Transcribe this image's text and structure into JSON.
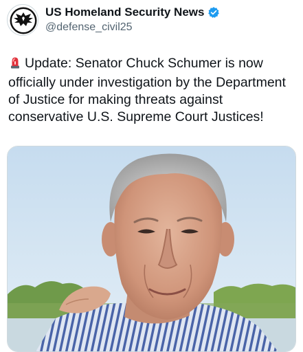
{
  "tweet": {
    "author": {
      "display_name": "US Homeland Security News",
      "handle": "@defense_civil25",
      "avatar_icon": "shield-eagle-logo",
      "verified_icon": "verified-badge-icon",
      "verified_color": "#1d9bf0"
    },
    "emoji_icon": "police-car-light-icon",
    "text": "Update: Senator Chuck Schumer is now officially under investigation by the Department of Justice for making threats against conservative U.S. Supreme Court Justices!"
  },
  "colors": {
    "text_primary": "#0f1419",
    "text_secondary": "#536471",
    "accent": "#1d9bf0"
  }
}
